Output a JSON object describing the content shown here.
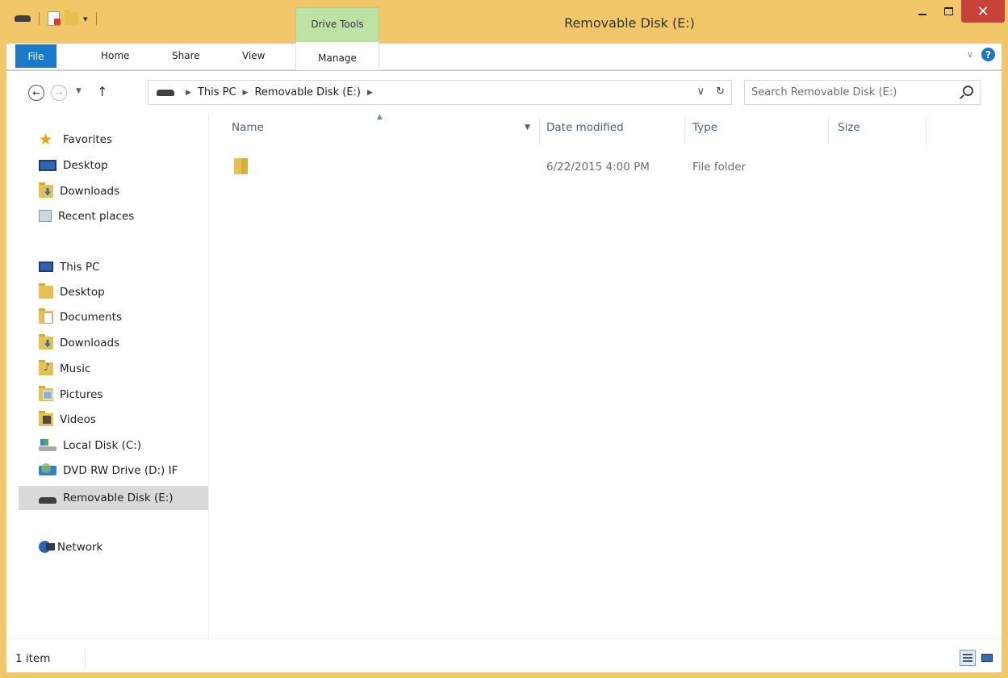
{
  "window": {
    "title": "Removable Disk (E:)",
    "context_tab_group": "Drive Tools",
    "close_glyph": "✕"
  },
  "ribbon": {
    "tabs": [
      {
        "label": "File"
      },
      {
        "label": "Home"
      },
      {
        "label": "Share"
      },
      {
        "label": "View"
      },
      {
        "label": "Manage"
      }
    ],
    "help_glyph": "?"
  },
  "address": {
    "breadcrumbs": [
      "This PC",
      "Removable Disk (E:)"
    ],
    "search_placeholder": "Search Removable Disk (E:)"
  },
  "navigation": {
    "favorites_label": "Favorites",
    "favorites": [
      "Desktop",
      "Downloads",
      "Recent places"
    ],
    "this_pc_label": "This PC",
    "this_pc": [
      "Desktop",
      "Documents",
      "Downloads",
      "Music",
      "Pictures",
      "Videos",
      "Local Disk (C:)",
      "DVD RW Drive (D:) IF",
      "Removable Disk (E:)"
    ],
    "network_label": "Network"
  },
  "file_list": {
    "columns": [
      "Name",
      "Date modified",
      "Type",
      "Size"
    ],
    "rows": [
      {
        "name": "",
        "date_modified": "6/22/2015 4:00 PM",
        "type": "File folder",
        "size": ""
      }
    ]
  },
  "status": {
    "item_count": "1 item"
  }
}
